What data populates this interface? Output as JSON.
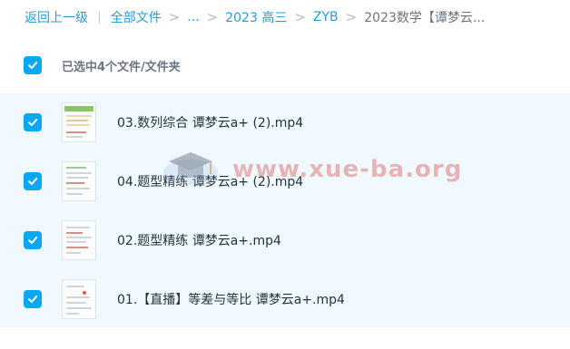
{
  "breadcrumb": {
    "back": "返回上一级",
    "all_files": "全部文件",
    "ellipsis": "...",
    "level1": "2023 高三",
    "level2": "ZYB",
    "current": "2023数学【谭梦云...",
    "separator": "|",
    "chevron": ">"
  },
  "selection": {
    "summary": "已选中4个文件/文件夹",
    "checked": true
  },
  "files": [
    {
      "name": "03.数列综合 谭梦云a+ (2).mp4",
      "checked": true,
      "icon": "video-thumbnail-icon"
    },
    {
      "name": "04.题型精练 谭梦云a+ (2).mp4",
      "checked": true,
      "icon": "video-thumbnail-icon"
    },
    {
      "name": "02.题型精练 谭梦云a+.mp4",
      "checked": true,
      "icon": "video-thumbnail-icon"
    },
    {
      "name": "01.【直播】等差与等比 谭梦云a+.mp4",
      "checked": true,
      "icon": "video-thumbnail-icon"
    }
  ],
  "watermark": {
    "text": "www.xue-ba.org"
  },
  "colors": {
    "accent": "#0aa8f2",
    "link": "#2a9bd6",
    "list_bg": "#f0f9fd",
    "watermark": "#d63030"
  }
}
